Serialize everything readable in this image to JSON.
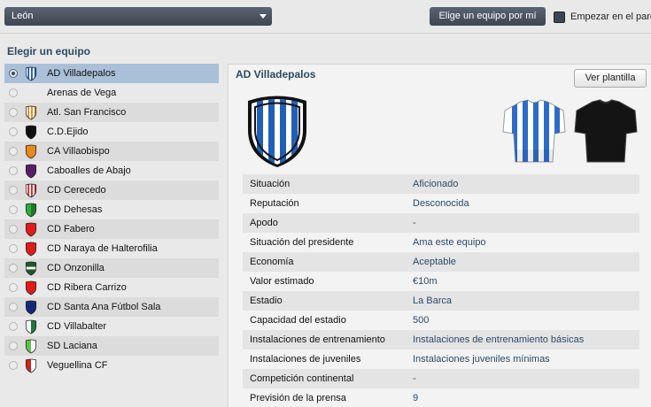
{
  "topbar": {
    "region_select": "León",
    "pick_button": "Elige un equipo por mí",
    "start_label": "Empezar en el paro"
  },
  "left": {
    "title": "Elegir un equipo",
    "teams": [
      {
        "name": "AD Villadepalos",
        "selected": true,
        "crest": "stripes-blue"
      },
      {
        "name": "Arenas de Vega",
        "selected": false,
        "crest": "none"
      },
      {
        "name": "Atl. San Francisco",
        "selected": false,
        "crest": "stripes-orange"
      },
      {
        "name": "C.D.Ejido",
        "selected": false,
        "crest": "black-red"
      },
      {
        "name": "CA Villaobispo",
        "selected": false,
        "crest": "orange"
      },
      {
        "name": "Caboalles de Abajo",
        "selected": false,
        "crest": "purple"
      },
      {
        "name": "CD Cerecedo",
        "selected": false,
        "crest": "stripes-red"
      },
      {
        "name": "CD Dehesas",
        "selected": false,
        "crest": "green"
      },
      {
        "name": "CD Fabero",
        "selected": false,
        "crest": "red"
      },
      {
        "name": "CD Naraya de Halterofilia",
        "selected": false,
        "crest": "red"
      },
      {
        "name": "CD Onzonilla",
        "selected": false,
        "crest": "green-dark"
      },
      {
        "name": "CD Ribera Carrizo",
        "selected": false,
        "crest": "red"
      },
      {
        "name": "CD Santa Ana Fútbol Sala",
        "selected": false,
        "crest": "navy"
      },
      {
        "name": "CD Villabalter",
        "selected": false,
        "crest": "green-white"
      },
      {
        "name": "SD Laciana",
        "selected": false,
        "crest": "green-light"
      },
      {
        "name": "Veguellina CF",
        "selected": false,
        "crest": "red-white"
      }
    ]
  },
  "detail": {
    "title": "AD Villadepalos",
    "squad_button": "Ver plantilla",
    "rows": [
      {
        "key": "Situación",
        "value": "Aficionado"
      },
      {
        "key": "Reputación",
        "value": "Desconocida"
      },
      {
        "key": "Apodo",
        "value": "-"
      },
      {
        "key": "Situación del presidente",
        "value": "Ama este equipo"
      },
      {
        "key": "Economía",
        "value": "Aceptable"
      },
      {
        "key": "Valor estimado",
        "value": "€10m"
      },
      {
        "key": "Estadio",
        "value": "La Barca"
      },
      {
        "key": "Capacidad del estadio",
        "value": "500"
      },
      {
        "key": "Instalaciones de entrenamiento",
        "value": "Instalaciones de entrenamiento básicas"
      },
      {
        "key": "Instalaciones de juveniles",
        "value": "Instalaciones juveniles mínimas"
      },
      {
        "key": "Competición continental",
        "value": "-"
      },
      {
        "key": "Previsión de la prensa",
        "value": "9"
      }
    ]
  },
  "colors": {
    "title_blue": "#2c4a63",
    "selected_row": "#a9c0d8",
    "value_blue": "#2a4a6a"
  }
}
